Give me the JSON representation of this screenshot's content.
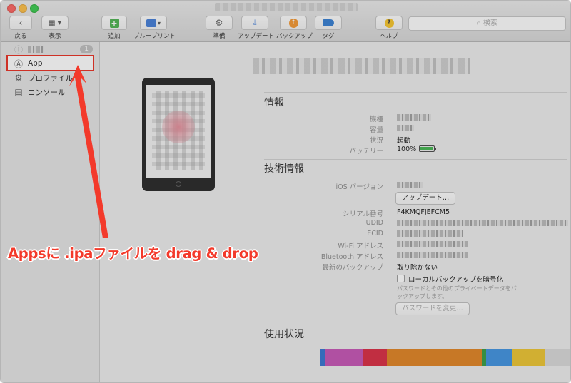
{
  "toolbar": {
    "back_label": "戻る",
    "view_label": "表示",
    "add_label": "追加",
    "blueprint_label": "ブループリント",
    "prepare_label": "準備",
    "update_label": "アップデート",
    "backup_label": "バックアップ",
    "tag_label": "タグ",
    "help_label": "ヘルプ",
    "search_placeholder": "検索"
  },
  "sidebar": {
    "items": [
      {
        "label": "App",
        "icon": "app-store-icon"
      },
      {
        "label": "プロファイル",
        "icon": "gear-icon"
      },
      {
        "label": "コンソール",
        "icon": "console-icon"
      }
    ],
    "badge": "1"
  },
  "info": {
    "title": "情報",
    "rows": [
      {
        "label": "機種"
      },
      {
        "label": "容量"
      },
      {
        "label": "状況",
        "value": "起動"
      },
      {
        "label": "バッテリー",
        "value": "100%"
      }
    ]
  },
  "tech": {
    "title": "技術情報",
    "ios_label": "iOS バージョン",
    "update_button": "アップデート…",
    "serial_label": "シリアル番号",
    "serial_value": "F4KMQFJEFCM5",
    "udid_label": "UDID",
    "ecid_label": "ECID",
    "wifi_label": "Wi-Fi アドレス",
    "bt_label": "Bluetooth アドレス",
    "backup_label": "最新のバックアップ",
    "backup_value": "取り除かない",
    "encrypt_label": "ローカルバックアップを暗号化",
    "encrypt_note": "パスワードとその他のプライベートデータをバックアップします。",
    "change_password": "パスワードを変更…"
  },
  "usage": {
    "title": "使用状況",
    "segments": [
      {
        "color": "#2f6fd0",
        "value": 2
      },
      {
        "color": "#c44fb2",
        "value": 16
      },
      {
        "color": "#d8253c",
        "value": 10
      },
      {
        "color": "#e07f1c",
        "value": 40
      },
      {
        "color": "#2e9a3f",
        "value": 2
      },
      {
        "color": "#3a8fe0",
        "value": 11
      },
      {
        "color": "#ecc22a",
        "value": 14
      },
      {
        "color": "#d7d7d7",
        "value": 11
      }
    ]
  },
  "annotation": {
    "text": "Appsに .ipaファイルを drag & drop",
    "color": "#f33a2b"
  }
}
